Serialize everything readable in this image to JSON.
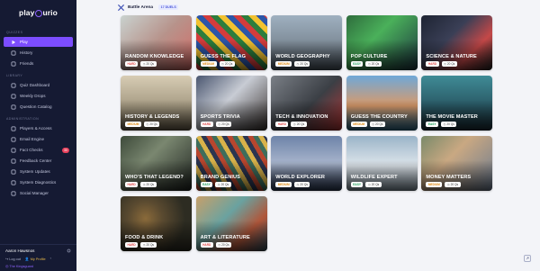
{
  "brand": {
    "logo_text_1": "play",
    "logo_text_2": "urio"
  },
  "sidebar": {
    "sections": [
      {
        "title": "QUIZZES",
        "items": [
          {
            "label": "Play",
            "icon": "play-icon",
            "active": true
          },
          {
            "label": "History",
            "icon": "history-icon"
          },
          {
            "label": "Friends",
            "icon": "friends-icon"
          }
        ]
      },
      {
        "title": "LIBRARY",
        "items": [
          {
            "label": "Quiz Dashboard",
            "icon": "dashboard-icon"
          },
          {
            "label": "Weekly Drops",
            "icon": "calendar-icon"
          },
          {
            "label": "Question Catalog",
            "icon": "catalog-icon"
          }
        ]
      },
      {
        "title": "ADMINISTRATION",
        "items": [
          {
            "label": "Players & Access",
            "icon": "players-icon"
          },
          {
            "label": "Email Engine",
            "icon": "email-icon"
          },
          {
            "label": "Fact Checks",
            "icon": "factcheck-icon",
            "badge": "30"
          },
          {
            "label": "Feedback Center",
            "icon": "feedback-icon"
          },
          {
            "label": "System Updates",
            "icon": "updates-icon"
          },
          {
            "label": "System Diagnostics",
            "icon": "diagnostics-icon"
          },
          {
            "label": "Social Manager",
            "icon": "social-icon"
          }
        ]
      }
    ],
    "user": {
      "name": "Aaron Hawsnos",
      "logout": "Log out",
      "profile": "My Profile",
      "org": "The Kingsguard"
    }
  },
  "header": {
    "title": "Battle Arena",
    "duels": "17 DUELS"
  },
  "cards": [
    {
      "title": "RANDOM KNOWLEDGE",
      "difficulty": "HARD",
      "duration": "20 Qs",
      "bg": "linear-gradient(135deg,#c9d2cf 0%,#b7938b 50%,#d46c67 100%)"
    },
    {
      "title": "GUESS THE FLAG",
      "difficulty": "MEDIUM",
      "duration": "20 Qs",
      "bg": "repeating-linear-gradient(45deg,#d43c3c 0 6px,#2d7d3d 6px 12px,#f2c230 12px 18px,#2c56a8 18px 24px)"
    },
    {
      "title": "WORLD GEOGRAPHY",
      "difficulty": "MEDIUM",
      "duration": "20 Qs",
      "bg": "linear-gradient(180deg,#9fb0c0 0%,#7d8a96 55%,#4b5560 100%)"
    },
    {
      "title": "POP CULTURE",
      "difficulty": "EASY",
      "duration": "20 Qs",
      "bg": "linear-gradient(135deg,#2e6d3d 0%,#4ab05a 40%,#1c3540 100%)"
    },
    {
      "title": "SCIENCE & NATURE",
      "difficulty": "HARD",
      "duration": "20 Qs",
      "bg": "linear-gradient(135deg,#1e2433 0%,#3a3f56 40%,#c44848 70%,#222 100%)"
    },
    {
      "title": "HISTORY & LEGENDS",
      "difficulty": "MEDIUM",
      "duration": "20 Qs",
      "bg": "linear-gradient(180deg,#d7ccb4 0%,#a39880 60%,#6b604c 100%)"
    },
    {
      "title": "SPORTS TRIVIA",
      "difficulty": "HARD",
      "duration": "20 Qs",
      "bg": "linear-gradient(135deg,#4a5670 0%,#c8ccd4 45%,#3a3330 100%)"
    },
    {
      "title": "TECH & INNOVATION",
      "difficulty": "HARD",
      "duration": "20 Qs",
      "bg": "linear-gradient(135deg,#7a7f86 0%,#3b3f45 55%,#b43838 100%)"
    },
    {
      "title": "GUESS THE COUNTRY",
      "difficulty": "MEDIUM",
      "duration": "20 Qs",
      "bg": "linear-gradient(180deg,#6fa8d8 0%,#d99a6a 55%,#2e6b8a 100%)"
    },
    {
      "title": "THE MOVIE MASTER",
      "difficulty": "EASY",
      "duration": "20 Qs",
      "bg": "linear-gradient(180deg,#3f8b96 0%,#2a5a66 55%,#1a2c35 100%)"
    },
    {
      "title": "WHO'S THAT LEGEND?",
      "difficulty": "HARD",
      "duration": "20 Qs",
      "bg": "linear-gradient(135deg,#3d4a3a 0%,#7a8770 40%,#1f2420 100%)"
    },
    {
      "title": "BRAND GENIUS",
      "difficulty": "EASY",
      "duration": "20 Qs",
      "bg": "repeating-linear-gradient(60deg,#b8462e 0 5px,#3e6d5b 5px 10px,#d8b24a 10px 15px,#2b3550 15px 20px)"
    },
    {
      "title": "WORLD EXPLORER",
      "difficulty": "MEDIUM",
      "duration": "20 Qs",
      "bg": "linear-gradient(180deg,#6d83a8 0%,#a7b4cc 50%,#2c3a55 100%)"
    },
    {
      "title": "WILDLIFE EXPERT",
      "difficulty": "EASY",
      "duration": "20 Qs",
      "bg": "linear-gradient(180deg,#9ab4c8 0%,#dfe6ec 55%,#8a9aa6 100%)"
    },
    {
      "title": "MONEY MATTERS",
      "difficulty": "MEDIUM",
      "duration": "20 Qs",
      "bg": "linear-gradient(135deg,#7a8a6a 0%,#c9a882 40%,#6a7a90 100%)"
    },
    {
      "title": "FOOD & DRINK",
      "difficulty": "HARD",
      "duration": "20 Qs",
      "bg": "radial-gradient(circle at 35% 40%,#8a6a3a 0%,#5a4a30 30%,#2d2c22 70%)"
    },
    {
      "title": "ART & LITERATURE",
      "difficulty": "HARD",
      "duration": "20 Qs",
      "bg": "linear-gradient(135deg,#c7a06a 0%,#6aa2a0 40%,#b0563a 70%,#2f4a5a 100%)"
    }
  ]
}
